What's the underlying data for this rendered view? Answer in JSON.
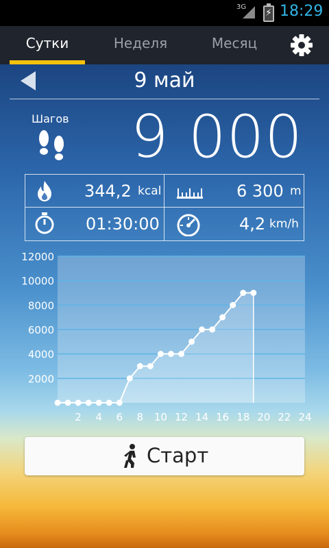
{
  "status_bar": {
    "network": "3G",
    "time": "18:29"
  },
  "tabs": [
    {
      "label": "Сутки",
      "active": true
    },
    {
      "label": "Неделя",
      "active": false
    },
    {
      "label": "Месяц",
      "active": false
    }
  ],
  "settings_icon": "gear-icon",
  "date_nav": {
    "back_icon": "left-arrow-icon",
    "date": "9 май"
  },
  "steps": {
    "label": "Шагов",
    "value": "9 000",
    "icon": "footprints-icon"
  },
  "stats": {
    "calories": {
      "value": "344,2",
      "unit": "kcal",
      "icon": "flame-icon"
    },
    "distance": {
      "value": "6 300",
      "unit": "m",
      "icon": "ruler-icon"
    },
    "duration": {
      "value": "01:30:00",
      "icon": "stopwatch-icon"
    },
    "speed": {
      "value": "4,2",
      "unit": "km/h",
      "icon": "speedometer-icon"
    }
  },
  "chart_data": {
    "type": "line",
    "x": [
      0,
      1,
      2,
      3,
      4,
      5,
      6,
      7,
      8,
      9,
      10,
      11,
      12,
      13,
      14,
      15,
      16,
      17,
      18,
      19
    ],
    "y": [
      0,
      0,
      0,
      0,
      0,
      0,
      0,
      2000,
      3000,
      3000,
      4000,
      4000,
      4000,
      5000,
      6000,
      6000,
      7000,
      8000,
      9000,
      9000
    ],
    "x_ticks": [
      2,
      4,
      6,
      8,
      10,
      12,
      14,
      16,
      18,
      20,
      22,
      24
    ],
    "y_ticks": [
      2000,
      4000,
      6000,
      8000,
      10000,
      12000
    ],
    "xlim": [
      0,
      24
    ],
    "ylim": [
      0,
      12000
    ],
    "grid": true,
    "colors": {
      "line": "#ffffff",
      "fill": "#ffffff",
      "grid": "#5fb3e6"
    }
  },
  "start_button": {
    "label": "Старт",
    "icon": "walking-person-icon"
  }
}
